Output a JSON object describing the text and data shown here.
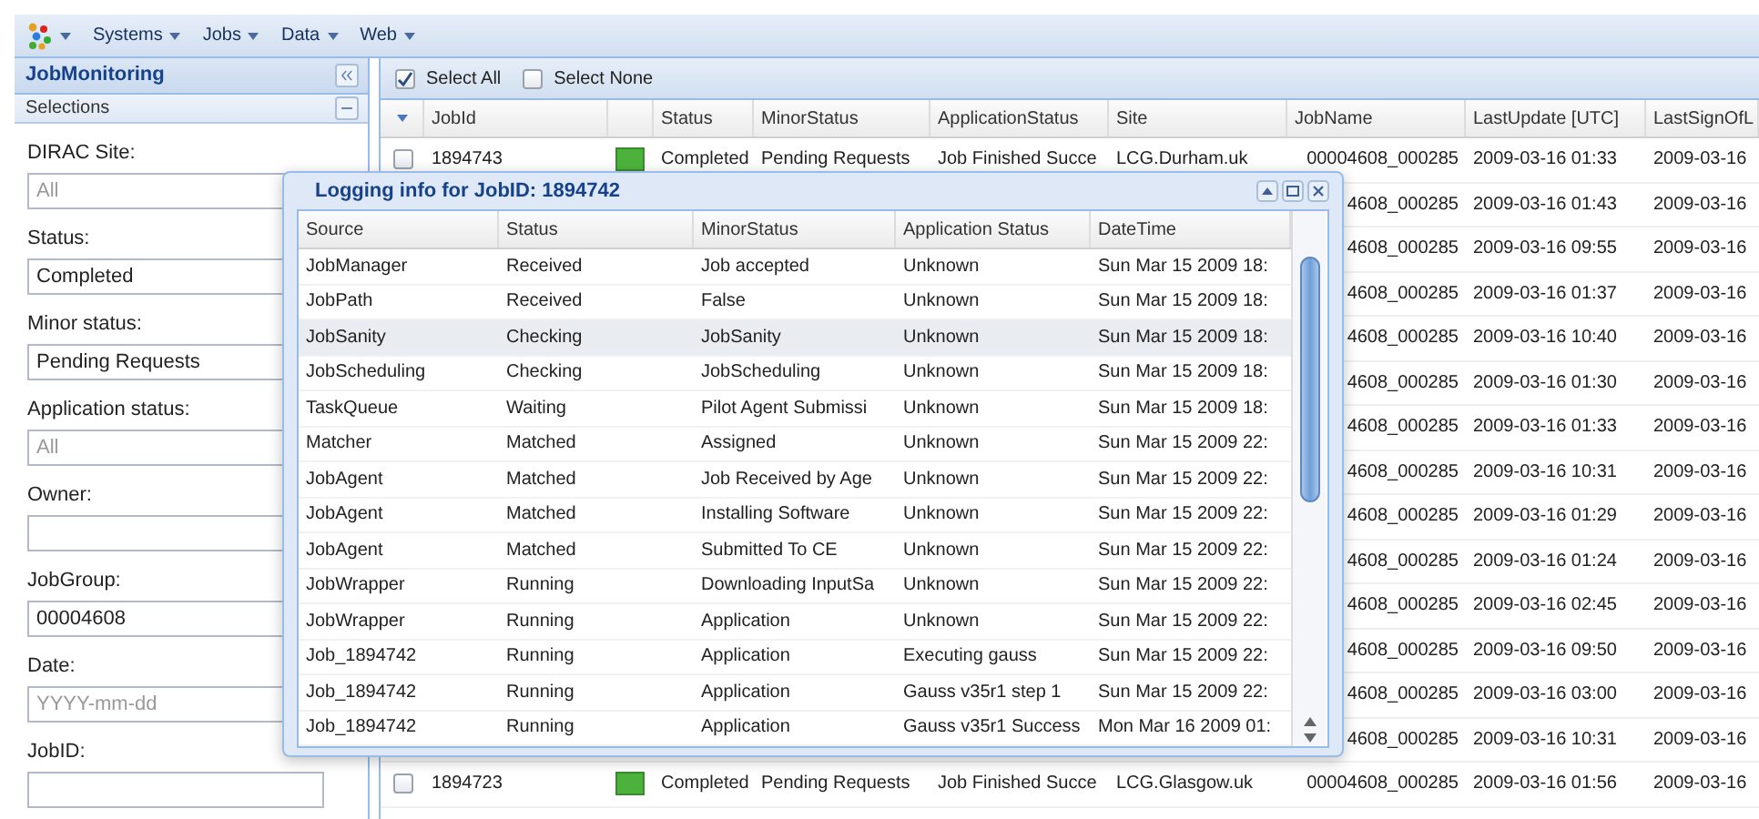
{
  "menu": [
    "Systems",
    "Jobs",
    "Data",
    "Web"
  ],
  "panel": {
    "title": "JobMonitoring",
    "section": "Selections",
    "fields": [
      {
        "label": "DIRAC Site:",
        "placeholder": "All"
      },
      {
        "label": "Status:",
        "value": "Completed"
      },
      {
        "label": "Minor status:",
        "value": "Pending Requests"
      },
      {
        "label": "Application status:",
        "placeholder": "All"
      },
      {
        "label": "Owner:"
      },
      {
        "label": "JobGroup:",
        "value": "00004608"
      },
      {
        "label": "Date:",
        "placeholder": "YYYY-mm-dd"
      },
      {
        "label": "JobID:"
      }
    ]
  },
  "grid": {
    "toolbar": [
      {
        "label": "Select All",
        "checked": true
      },
      {
        "label": "Select None",
        "checked": false
      }
    ],
    "columns": [
      "JobId",
      "Status",
      "MinorStatus",
      "ApplicationStatus",
      "Site",
      "JobName",
      "LastUpdate [UTC]",
      "LastSignOfL"
    ],
    "rows": [
      {
        "checked": false,
        "jobid": "1894743",
        "color": "#4cb23c",
        "status": "Completed",
        "minor_status": "Pending Requests",
        "application_status": "Job Finished Succe",
        "site": "LCG.Durham.uk",
        "job_name": "00004608_000285",
        "last_update": "2009-03-16 01:33",
        "last_sign_of": "2009-03-16"
      },
      {
        "job_name": "4608_000285",
        "last_update": "2009-03-16 01:43",
        "last_sign_of": "2009-03-16"
      },
      {
        "job_name": "4608_000285",
        "last_update": "2009-03-16 09:55",
        "last_sign_of": "2009-03-16"
      },
      {
        "job_name": "4608_000285",
        "last_update": "2009-03-16 01:37",
        "last_sign_of": "2009-03-16"
      },
      {
        "job_name": "4608_000285",
        "last_update": "2009-03-16 10:40",
        "last_sign_of": "2009-03-16"
      },
      {
        "job_name": "4608_000285",
        "last_update": "2009-03-16 01:30",
        "last_sign_of": "2009-03-16"
      },
      {
        "job_name": "4608_000285",
        "last_update": "2009-03-16 01:33",
        "last_sign_of": "2009-03-16"
      },
      {
        "job_name": "4608_000285",
        "last_update": "2009-03-16 10:31",
        "last_sign_of": "2009-03-16"
      },
      {
        "job_name": "4608_000285",
        "last_update": "2009-03-16 01:29",
        "last_sign_of": "2009-03-16"
      },
      {
        "job_name": "4608_000285",
        "last_update": "2009-03-16 01:24",
        "last_sign_of": "2009-03-16"
      },
      {
        "job_name": "4608_000285",
        "last_update": "2009-03-16 02:45",
        "last_sign_of": "2009-03-16"
      },
      {
        "job_name": "4608_000285",
        "last_update": "2009-03-16 09:50",
        "last_sign_of": "2009-03-16"
      },
      {
        "job_name": "4608_000285",
        "last_update": "2009-03-16 03:00",
        "last_sign_of": "2009-03-16"
      },
      {
        "job_name": "4608_000285",
        "last_update": "2009-03-16 10:31",
        "last_sign_of": "2009-03-16"
      },
      {
        "checked": false,
        "jobid": "1894723",
        "color": "#4cb23c",
        "status": "Completed",
        "minor_status": "Pending Requests",
        "application_status": "Job Finished Succe",
        "site": "LCG.Glasgow.uk",
        "job_name": "00004608_000285",
        "last_update": "2009-03-16 01:56",
        "last_sign_of": "2009-03-16"
      }
    ]
  },
  "log_window": {
    "title": "Logging info for JobID: 1894742",
    "columns": [
      "Source",
      "Status",
      "MinorStatus",
      "Application Status",
      "DateTime"
    ],
    "rows": [
      {
        "source": "JobManager",
        "status": "Received",
        "minor_status": "Job accepted",
        "application_status": "Unknown",
        "date_time": "Sun Mar 15 2009 18:",
        "highlighted": false
      },
      {
        "source": "JobPath",
        "status": "Received",
        "minor_status": "False",
        "application_status": "Unknown",
        "date_time": "Sun Mar 15 2009 18:",
        "highlighted": false
      },
      {
        "source": "JobSanity",
        "status": "Checking",
        "minor_status": "JobSanity",
        "application_status": "Unknown",
        "date_time": "Sun Mar 15 2009 18:",
        "highlighted": true
      },
      {
        "source": "JobScheduling",
        "status": "Checking",
        "minor_status": "JobScheduling",
        "application_status": "Unknown",
        "date_time": "Sun Mar 15 2009 18:",
        "highlighted": false
      },
      {
        "source": "TaskQueue",
        "status": "Waiting",
        "minor_status": "Pilot Agent Submissi",
        "application_status": "Unknown",
        "date_time": "Sun Mar 15 2009 18:",
        "highlighted": false
      },
      {
        "source": "Matcher",
        "status": "Matched",
        "minor_status": "Assigned",
        "application_status": "Unknown",
        "date_time": "Sun Mar 15 2009 22:",
        "highlighted": false
      },
      {
        "source": "JobAgent",
        "status": "Matched",
        "minor_status": "Job Received by Age",
        "application_status": "Unknown",
        "date_time": "Sun Mar 15 2009 22:",
        "highlighted": false
      },
      {
        "source": "JobAgent",
        "status": "Matched",
        "minor_status": "Installing Software",
        "application_status": "Unknown",
        "date_time": "Sun Mar 15 2009 22:",
        "highlighted": false
      },
      {
        "source": "JobAgent",
        "status": "Matched",
        "minor_status": "Submitted To CE",
        "application_status": "Unknown",
        "date_time": "Sun Mar 15 2009 22:",
        "highlighted": false
      },
      {
        "source": "JobWrapper",
        "status": "Running",
        "minor_status": "Downloading InputSa",
        "application_status": "Unknown",
        "date_time": "Sun Mar 15 2009 22:",
        "highlighted": false
      },
      {
        "source": "JobWrapper",
        "status": "Running",
        "minor_status": "Application",
        "application_status": "Unknown",
        "date_time": "Sun Mar 15 2009 22:",
        "highlighted": false
      },
      {
        "source": "Job_1894742",
        "status": "Running",
        "minor_status": "Application",
        "application_status": "Executing gauss",
        "date_time": "Sun Mar 15 2009 22:",
        "highlighted": false
      },
      {
        "source": "Job_1894742",
        "status": "Running",
        "minor_status": "Application",
        "application_status": "Gauss v35r1 step 1",
        "date_time": "Sun Mar 15 2009 22:",
        "highlighted": false
      },
      {
        "source": "Job_1894742",
        "status": "Running",
        "minor_status": "Application",
        "application_status": "Gauss v35r1 Success",
        "date_time": "Mon Mar 16 2009 01:",
        "highlighted": false
      }
    ]
  }
}
